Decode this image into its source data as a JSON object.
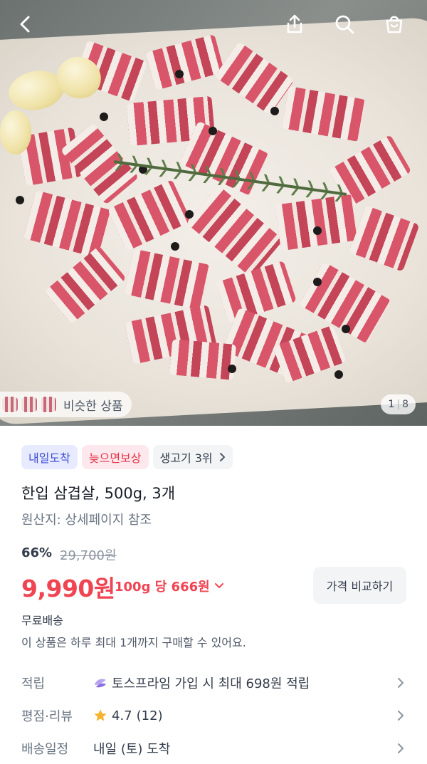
{
  "nav": {
    "back_icon": "chevron-left-icon",
    "share_icon": "share-icon",
    "search_icon": "search-icon",
    "cart_icon": "shopping-bag-icon"
  },
  "hero": {
    "similar_label": "비슷한 상품",
    "page_current": "1",
    "page_total": "8"
  },
  "tags": {
    "arrival": "내일도착",
    "late_comp": "늦으면보상",
    "rank": "생고기 3위"
  },
  "product": {
    "title": "한입 삼겹살, 500g, 3개",
    "origin": "원산지: 상세페이지 참조"
  },
  "pricing": {
    "discount": "66%",
    "original_price": "29,700원",
    "price": "9,990원",
    "unit_price": "100g 당 666원",
    "compare_label": "가격 비교하기"
  },
  "shipping": {
    "label": "무료배송",
    "limit_notice": "이 상품은 하루 최대 1개까지 구매할 수 있어요."
  },
  "rows": {
    "points": {
      "label": "적립",
      "value": "토스프라임 가입 시 최대 698원 적립"
    },
    "rating": {
      "label": "평점·리뷰",
      "score": "4.7",
      "count": "(12)"
    },
    "delivery": {
      "label": "배송일정",
      "value": "내일 (토) 도착"
    }
  },
  "colors": {
    "price_red": "#f04452",
    "tag_blue_text": "#3d4dd6",
    "tag_red_text": "#e5384a",
    "star": "#f5b32e"
  }
}
